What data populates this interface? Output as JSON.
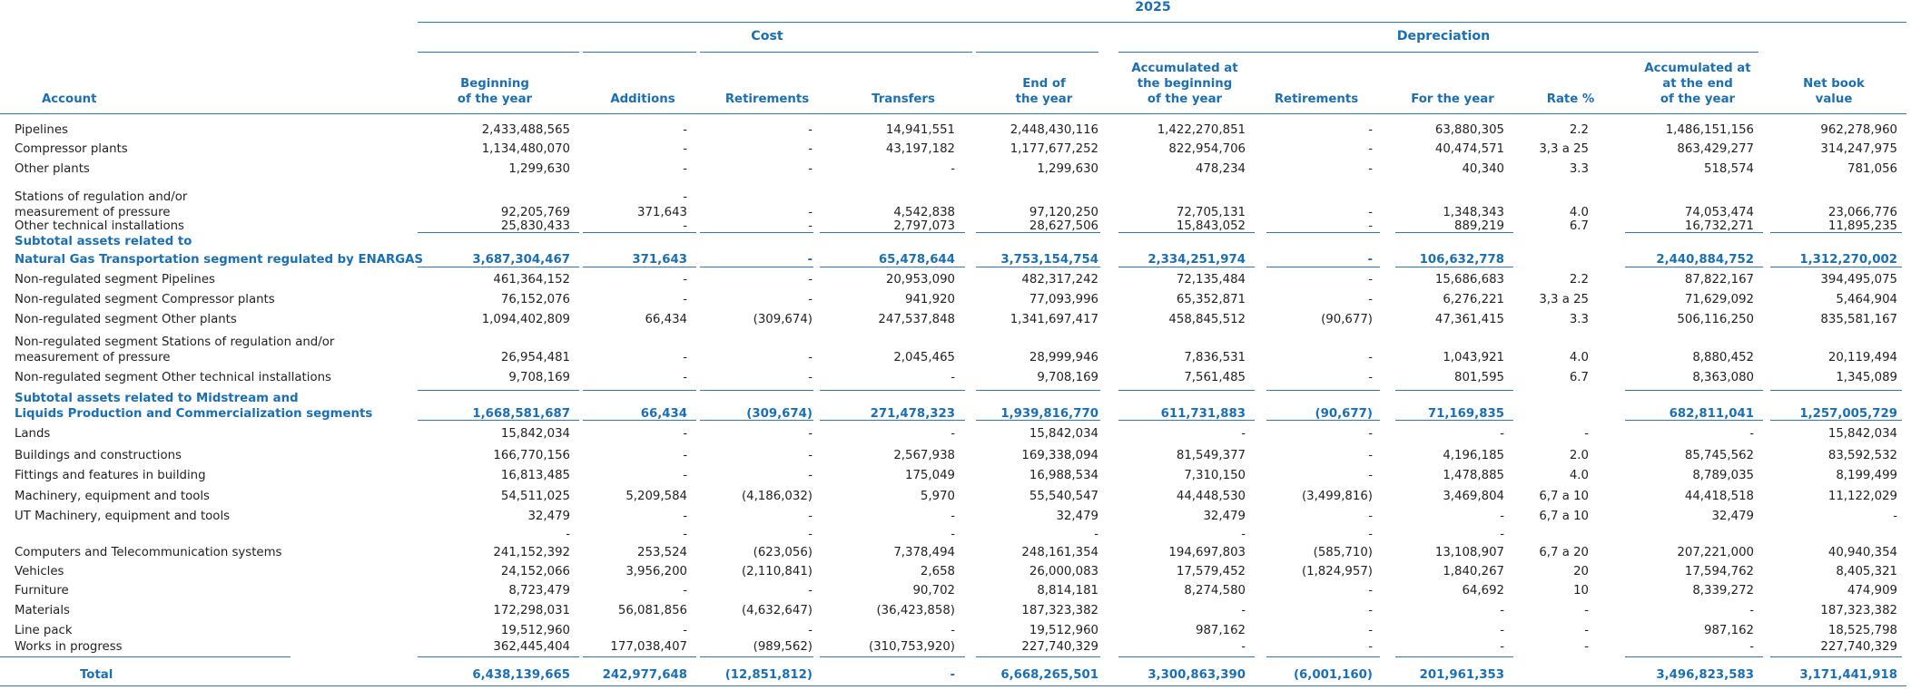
{
  "header": {
    "year": "2025",
    "cost_group": "Cost",
    "dep_group": "Depreciation",
    "columns": {
      "account": "Account",
      "beg_l1": "Beginning",
      "beg_l2": "of the year",
      "additions": "Additions",
      "retirements": "Retirements",
      "transfers": "Transfers",
      "end_l1": "End of",
      "end_l2": "the year",
      "acc_beg_l1": "Accumulated at",
      "acc_beg_l2": "the beginning",
      "acc_beg_l3": "of the year",
      "dep_retirements": "Retirements",
      "for_year": "For the year",
      "rate": "Rate %",
      "acc_end_l1": "Accumulated at",
      "acc_end_l2": "at the end",
      "acc_end_l3": "of the year",
      "nbv_l1": "Net book",
      "nbv_l2": "value"
    }
  },
  "rows": [
    {
      "label": "Pipelines",
      "v": [
        "2,433,488,565",
        "-",
        "-",
        "14,941,551",
        "2,448,430,116",
        "1,422,270,851",
        "-",
        "63,880,305",
        "2.2",
        "1,486,151,156",
        "962,278,960"
      ]
    },
    {
      "label": "Compressor plants",
      "v": [
        "1,134,480,070",
        "-",
        "-",
        "43,197,182",
        "1,177,677,252",
        "822,954,706",
        "-",
        "40,474,571",
        "3,3 a 25",
        "863,429,277",
        "314,247,975"
      ]
    },
    {
      "label": "Other plants",
      "v": [
        "1,299,630",
        "-",
        "-",
        "-",
        "1,299,630",
        "478,234",
        "-",
        "40,340",
        "3.3",
        "518,574",
        "781,056"
      ]
    },
    {
      "label": "Stations of regulation and/or",
      "label2": "measurement of pressure",
      "v": [
        "92,205,769",
        "371,643",
        "-",
        "4,542,838",
        "97,120,250",
        "72,705,131",
        "-",
        "1,348,343",
        "4.0",
        "74,053,474",
        "23,066,776"
      ],
      "extra": "-"
    },
    {
      "label": "Other technical installations",
      "v": [
        "25,830,433",
        "-",
        "-",
        "2,797,073",
        "28,627,506",
        "15,843,052",
        "-",
        "889,219",
        "6.7",
        "16,732,271",
        "11,895,235"
      ]
    },
    {
      "label": "Subtotal assets related to",
      "label2": "Natural Gas Transportation segment regulated by ENARGAS",
      "subtotal": true,
      "v": [
        "3,687,304,467",
        "371,643",
        "-",
        "65,478,644",
        "3,753,154,754",
        "2,334,251,974",
        "-",
        "106,632,778",
        "",
        "2,440,884,752",
        "1,312,270,002"
      ]
    },
    {
      "label": "Non-regulated segment Pipelines",
      "v": [
        "461,364,152",
        "-",
        "-",
        "20,953,090",
        "482,317,242",
        "72,135,484",
        "-",
        "15,686,683",
        "2.2",
        "87,822,167",
        "394,495,075"
      ]
    },
    {
      "label": "Non-regulated segment Compressor plants",
      "v": [
        "76,152,076",
        "-",
        "-",
        "941,920",
        "77,093,996",
        "65,352,871",
        "-",
        "6,276,221",
        "3,3 a 25",
        "71,629,092",
        "5,464,904"
      ]
    },
    {
      "label": "Non-regulated segment Other plants",
      "v": [
        "1,094,402,809",
        "66,434",
        "(309,674)",
        "247,537,848",
        "1,341,697,417",
        "458,845,512",
        "(90,677)",
        "47,361,415",
        "3.3",
        "506,116,250",
        "835,581,167"
      ]
    },
    {
      "label": "Non-regulated segment Stations of regulation and/or",
      "label2": "measurement of pressure",
      "v": [
        "26,954,481",
        "-",
        "-",
        "2,045,465",
        "28,999,946",
        "7,836,531",
        "-",
        "1,043,921",
        "4.0",
        "8,880,452",
        "20,119,494"
      ]
    },
    {
      "label": "Non-regulated segment Other technical installations",
      "v": [
        "9,708,169",
        "-",
        "-",
        "-",
        "9,708,169",
        "7,561,485",
        "-",
        "801,595",
        "6.7",
        "8,363,080",
        "1,345,089"
      ]
    },
    {
      "label": "Subtotal assets related to Midstream and",
      "label2": "Liquids Production and Commercialization segments",
      "subtotal": true,
      "v": [
        "1,668,581,687",
        "66,434",
        "(309,674)",
        "271,478,323",
        "1,939,816,770",
        "611,731,883",
        "(90,677)",
        "71,169,835",
        "",
        "682,811,041",
        "1,257,005,729"
      ]
    },
    {
      "label": "Lands",
      "v": [
        "15,842,034",
        "-",
        "-",
        "-",
        "15,842,034",
        "-",
        "-",
        "-",
        "-",
        "-",
        "15,842,034"
      ]
    },
    {
      "label": "Buildings and constructions",
      "v": [
        "166,770,156",
        "-",
        "-",
        "2,567,938",
        "169,338,094",
        "81,549,377",
        "-",
        "4,196,185",
        "2.0",
        "85,745,562",
        "83,592,532"
      ]
    },
    {
      "label": "Fittings and features in building",
      "v": [
        "16,813,485",
        "-",
        "-",
        "175,049",
        "16,988,534",
        "7,310,150",
        "-",
        "1,478,885",
        "4.0",
        "8,789,035",
        "8,199,499"
      ]
    },
    {
      "label": "Machinery, equipment and tools",
      "v": [
        "54,511,025",
        "5,209,584",
        "(4,186,032)",
        "5,970",
        "55,540,547",
        "44,448,530",
        "(3,499,816)",
        "3,469,804",
        "6,7 a 10",
        "44,418,518",
        "11,122,029"
      ]
    },
    {
      "label": "UT Machinery, equipment and tools",
      "v": [
        "32,479",
        "-",
        "-",
        "-",
        "32,479",
        "32,479",
        "-",
        "-",
        "6,7 a 10",
        "32,479",
        "-"
      ]
    },
    {
      "label": "",
      "v": [
        "-",
        "-",
        "-",
        "-",
        "-",
        "-",
        "-",
        "-",
        "",
        "",
        ""
      ]
    },
    {
      "label": "Computers and Telecommunication systems",
      "v": [
        "241,152,392",
        "253,524",
        "(623,056)",
        "7,378,494",
        "248,161,354",
        "194,697,803",
        "(585,710)",
        "13,108,907",
        "6,7 a 20",
        "207,221,000",
        "40,940,354"
      ]
    },
    {
      "label": "Vehicles",
      "v": [
        "24,152,066",
        "3,956,200",
        "(2,110,841)",
        "2,658",
        "26,000,083",
        "17,579,452",
        "(1,824,957)",
        "1,840,267",
        "20",
        "17,594,762",
        "8,405,321"
      ]
    },
    {
      "label": "Furniture",
      "v": [
        "8,723,479",
        "-",
        "-",
        "90,702",
        "8,814,181",
        "8,274,580",
        "-",
        "64,692",
        "10",
        "8,339,272",
        "474,909"
      ]
    },
    {
      "label": "Materials",
      "v": [
        "172,298,031",
        "56,081,856",
        "(4,632,647)",
        "(36,423,858)",
        "187,323,382",
        "-",
        "-",
        "-",
        "-",
        "-",
        "187,323,382"
      ]
    },
    {
      "label": "Line pack",
      "v": [
        "19,512,960",
        "-",
        "-",
        "-",
        "19,512,960",
        "987,162",
        "-",
        "-",
        "-",
        "987,162",
        "18,525,798"
      ]
    },
    {
      "label": "Works in progress",
      "v": [
        "362,445,404",
        "177,038,407",
        "(989,562)",
        "(310,753,920)",
        "227,740,329",
        "-",
        "-",
        "-",
        "-",
        "-",
        "227,740,329"
      ]
    }
  ],
  "total": {
    "label": "Total",
    "v": [
      "6,438,139,665",
      "242,977,648",
      "(12,851,812)",
      "-",
      "6,668,265,501",
      "3,300,863,390",
      "(6,001,160)",
      "201,961,353",
      "",
      "3,496,823,583",
      "3,171,441,918"
    ]
  }
}
